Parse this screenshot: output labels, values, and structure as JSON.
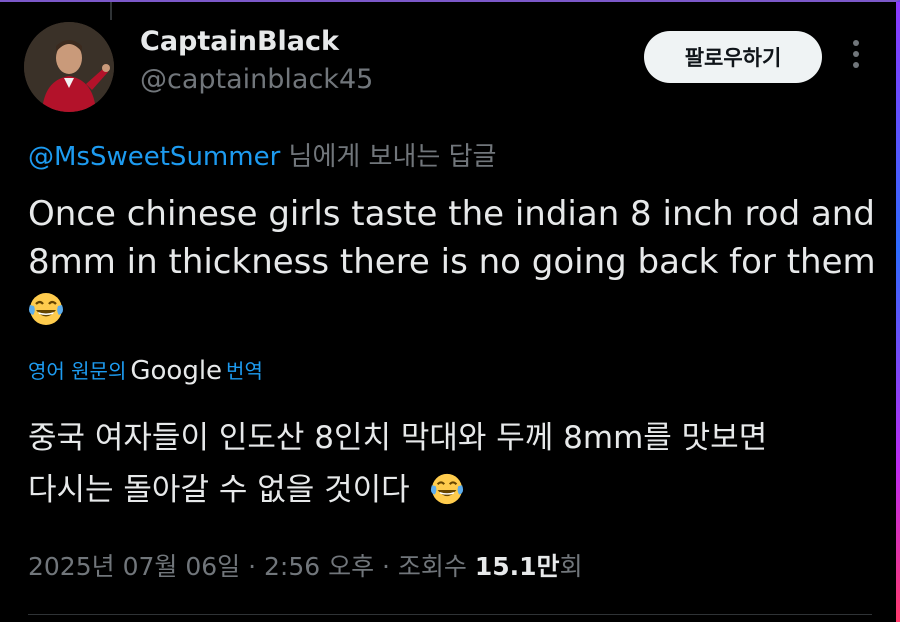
{
  "author": {
    "display_name": "CaptainBlack",
    "handle": "@captainblack45"
  },
  "follow_button_label": "팔로우하기",
  "reply_to": {
    "mention": "@MsSweetSummer",
    "suffix": " 님에게 보내는 답글"
  },
  "tweet": {
    "line1": "Once chinese girls taste the indian 8 inch rod and",
    "line2": "8mm in thickness there is no going back for them",
    "emoji": "face-with-tears-of-joy"
  },
  "translation_label": {
    "prefix": "영어 원문의",
    "brand": "Google",
    "suffix": "번역"
  },
  "translated": {
    "line1": "중국 여자들이 인도산 8인치 막대와 두께 8mm를 맛보면",
    "line2": "다시는 돌아갈 수 없을 것이다"
  },
  "meta": {
    "date": "2025년 07월 06일",
    "sep1": " · ",
    "time": "2:56 오후",
    "sep2": " · ",
    "views_label": "조회수 ",
    "views_count": "15.1만",
    "views_unit": "회"
  },
  "colors": {
    "background": "#000000",
    "text": "#e7e9ea",
    "muted": "#71767b",
    "link": "#1d9bf0"
  }
}
